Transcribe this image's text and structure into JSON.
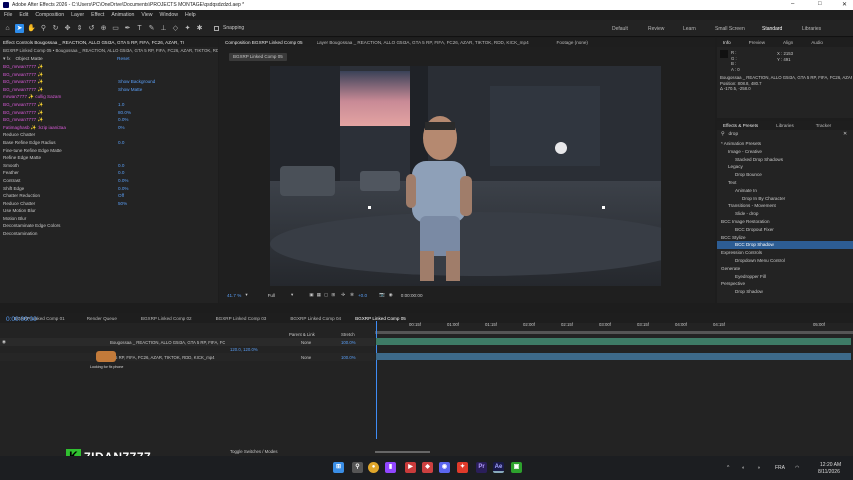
{
  "window": {
    "title": "Adobe After Effects 2026 - C:\\Users\\PC\\OneDrive\\Documents\\PROJECTS MONTAGE\\qsdqsdzdzd.aep *",
    "minimize": "–",
    "maximize": "□",
    "close": "✕"
  },
  "menu": [
    "File",
    "Edit",
    "Composition",
    "Layer",
    "Effect",
    "Animation",
    "View",
    "Window",
    "Help"
  ],
  "toolbar": {
    "snapping": "Snapping",
    "workspaces": [
      "Default",
      "Review",
      "Learn",
      "Small Screen",
      "Standard",
      "Libraries"
    ],
    "active_workspace": "Standard"
  },
  "effect_controls": {
    "tab": "Effect Controls Bougossaa _ REACTION, ALLO G5I3A, GTA 5 RP, FIFA, FC26, AZAR, TI",
    "subheader": "BGXRP Linked Comp 05 • Bougossaa _ REACTION, ALLO G5I3A, GTA 5 RP, FIFA, FC26, AZAR, TIKTOK, RDD, KICK_mp4",
    "effect_name": "Object Matte",
    "reset": "Reset",
    "rows": [
      {
        "label": "BG_mrwan7777 ✨",
        "cls": "mag",
        "value": ""
      },
      {
        "label": "BG_mrwan7777 ✨",
        "cls": "mag",
        "value": ""
      },
      {
        "label": "BG_mrwan7777 ✨",
        "cls": "mag",
        "value": "Show Background"
      },
      {
        "label": "BG_mrwan7777 ✨",
        "cls": "mag",
        "value": "Show Matte"
      },
      {
        "label": "mrwan7777 ✨ cullig Sazam",
        "cls": "mag",
        "value": ""
      },
      {
        "label": "BG_mrwan7777 ✨",
        "cls": "mag",
        "value": "1.0"
      },
      {
        "label": "BG_mrwan7777 ✨",
        "cls": "mag",
        "value": "80.0%"
      },
      {
        "label": "BG_mrwan7777 ✨",
        "cls": "mag",
        "value": "0.0%"
      },
      {
        "label": "Fatimaghasb ✨ :kzip iaani3aa",
        "cls": "mag",
        "value": "0%"
      },
      {
        "label": "Reduce Chatter",
        "cls": "",
        "value": ""
      },
      {
        "label": "Base Refine Edge Radius",
        "cls": "",
        "value": "0.0"
      },
      {
        "label": "Fine-tune Refine Edge Matte",
        "cls": "",
        "value": ""
      },
      {
        "label": "Refine Edge Matte",
        "cls": "",
        "value": ""
      },
      {
        "label": "Smooth",
        "cls": "",
        "value": "0.0"
      },
      {
        "label": "Feather",
        "cls": "",
        "value": "0.0"
      },
      {
        "label": "Contrast",
        "cls": "",
        "value": "0.0%"
      },
      {
        "label": "Shift Edge",
        "cls": "",
        "value": "0.0%"
      },
      {
        "label": "Chatter Reduction",
        "cls": "",
        "value": "Off"
      },
      {
        "label": "Reduce Chatter",
        "cls": "",
        "value": "50%"
      },
      {
        "label": "Use Motion Blur",
        "cls": "",
        "value": ""
      },
      {
        "label": "Motion Blur",
        "cls": "",
        "value": ""
      },
      {
        "label": "Decontaminate Edge Colors",
        "cls": "",
        "value": ""
      },
      {
        "label": "Decontamination",
        "cls": "",
        "value": ""
      }
    ]
  },
  "composition": {
    "tab1": "Composition BGXRP Linked Comp 05",
    "tab2": "Layer Bougossaa _ REACTION, ALLO G5I3A, GTA 5 RP, FIFA, FC26, AZAR, TIKTOK, RDD, KICK_mp4",
    "tab3": "Footage (none)",
    "comp_chip": "BGXRP Linked Comp 05",
    "zoom": "41.7 %",
    "quality": "Full",
    "exposure": "+0.0",
    "timecode": "0:00:00:00"
  },
  "info": {
    "tabs": [
      "Info",
      "Preview",
      "Align",
      "Audio"
    ],
    "r": "R :",
    "g": "G :",
    "b": "B :",
    "a": "A : 0",
    "x": "X : 2153",
    "y": "Y : 491",
    "line1": "Bougossaa _ REACTION, ALLO G5I3A, GTA 5 RP, FIFA, FC26, AZAR, TIKTOK, RDD, KICK_mp4",
    "line2": "Position: 808.8, 480.7",
    "line3": "Δ -170.5, -258.0"
  },
  "effects_presets": {
    "tabs": [
      "Effects & Presets",
      "Libraries",
      "Tracker"
    ],
    "search": "drop",
    "items": [
      {
        "label": "* Animation Presets",
        "indent": 0,
        "hl": false
      },
      {
        "label": "Image - Creative",
        "indent": 1,
        "hl": false
      },
      {
        "label": "Stacked Drop Shadows",
        "indent": 2,
        "hl": false
      },
      {
        "label": "Legacy",
        "indent": 1,
        "hl": false
      },
      {
        "label": "Drop Bounce",
        "indent": 2,
        "hl": false
      },
      {
        "label": "Text",
        "indent": 1,
        "hl": false
      },
      {
        "label": "Animate In",
        "indent": 2,
        "hl": false
      },
      {
        "label": "Drop In By Character",
        "indent": 3,
        "hl": false
      },
      {
        "label": "Transitions - Movement",
        "indent": 1,
        "hl": false
      },
      {
        "label": "Slide - drop",
        "indent": 2,
        "hl": false
      },
      {
        "label": "BCC Image Restoration",
        "indent": 0,
        "hl": false
      },
      {
        "label": "BCC Dropout Fixer",
        "indent": 2,
        "hl": false
      },
      {
        "label": "BCC Stylize",
        "indent": 0,
        "hl": false
      },
      {
        "label": "BCC Drop Shadow",
        "indent": 2,
        "hl": true
      },
      {
        "label": "Expression Controls",
        "indent": 0,
        "hl": false
      },
      {
        "label": "Dropdown Menu Control",
        "indent": 2,
        "hl": false
      },
      {
        "label": "Generate",
        "indent": 0,
        "hl": false
      },
      {
        "label": "Eyedropper Fill",
        "indent": 2,
        "hl": false
      },
      {
        "label": "Perspective",
        "indent": 0,
        "hl": false
      },
      {
        "label": "Drop Shadow",
        "indent": 2,
        "hl": false
      }
    ]
  },
  "timeline": {
    "tabs": [
      "BGXRP Linked Comp 01",
      "Render Queue",
      "BGXRP Linked Comp 02",
      "BGXRP Linked Comp 03",
      "BGXRP Linked Comp 04",
      "BGXRP Linked Comp 05"
    ],
    "timecode": "0:00:00:00",
    "ruler": [
      "00:00f",
      "00:15f",
      "01:00f",
      "01:15f",
      "02:00f",
      "02:15f",
      "03:00f",
      "03:15f",
      "04:00f",
      "04:15f",
      "05:00f"
    ],
    "col_parent": "Parent & Link",
    "col_stretch": "Stretch",
    "layers": [
      {
        "name": "Bougossaa _ REACTION, ALLO G5I3A, GTA 5 RP, FIFA, FC26, AZAR, TIKTOK, RDD, KICK_mp4",
        "parent": "None",
        "stretch": "100.0%"
      },
      {
        "name": "5 RP, FIFA, FC26, AZAR, TIKTOK, RDD, KICK_mp4",
        "parent": "None",
        "stretch": "100.0%"
      }
    ],
    "sub_value": "120.0, 120.0%",
    "toggle": "Toggle Switches / Modes",
    "loading": "Looking for fix phone"
  },
  "watermark": {
    "text": "7IDAN7777"
  },
  "taskbar": {
    "lang": "FRA",
    "time": "12:20 AM",
    "date": "8/11/2026"
  },
  "colors": {
    "accent": "#2d8ceb",
    "highlight": "#2d5d94",
    "timeline_bar": "#3e7b66",
    "playhead": "#3f8cf4"
  }
}
